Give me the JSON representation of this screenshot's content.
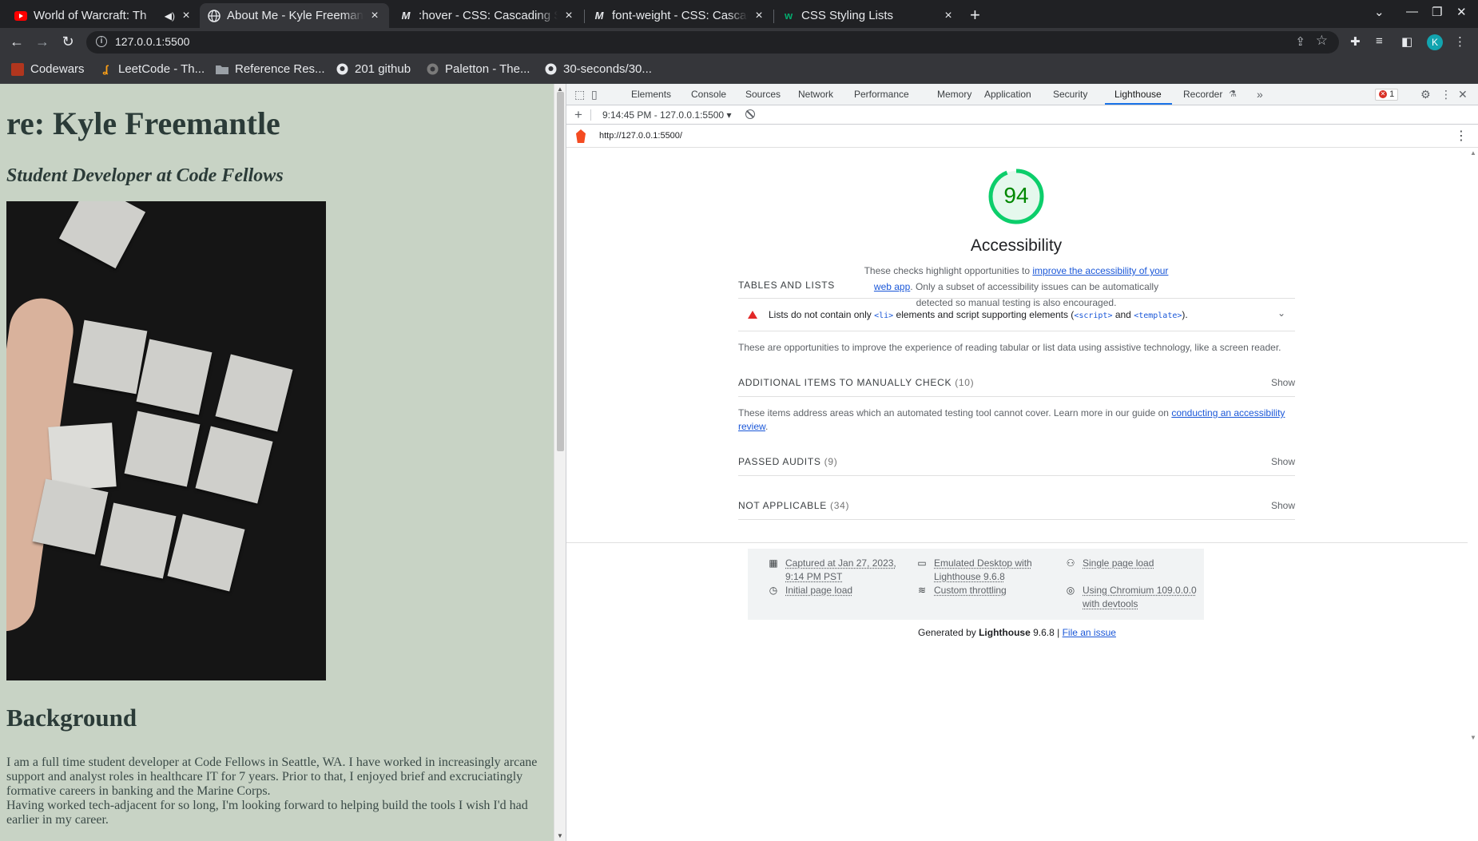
{
  "tabs": [
    {
      "title": "World of Warcraft: Th",
      "favicon": "youtube-icon",
      "audio": true
    },
    {
      "title": "About Me - Kyle Freemant",
      "favicon": "globe-icon",
      "active": true
    },
    {
      "title": ":hover - CSS: Cascading St",
      "favicon": "mdn-icon"
    },
    {
      "title": "font-weight - CSS: Cascad",
      "favicon": "mdn-icon"
    },
    {
      "title": "CSS Styling Lists",
      "favicon": "w3schools-icon"
    }
  ],
  "address": {
    "url": "127.0.0.1:5500"
  },
  "profile_initial": "K",
  "bookmarks": [
    {
      "label": "Codewars",
      "icon": "codewars-icon"
    },
    {
      "label": "LeetCode - Th...",
      "icon": "leetcode-icon"
    },
    {
      "label": "Reference Res...",
      "icon": "folder-icon"
    },
    {
      "label": "201 github",
      "icon": "github-icon"
    },
    {
      "label": "Paletton - The...",
      "icon": "paletton-icon"
    },
    {
      "label": "30-seconds/30...",
      "icon": "github-icon"
    }
  ],
  "page": {
    "heading": "re: Kyle Freemantle",
    "subtitle": "Student Developer at Code Fellows",
    "section_title": "Background",
    "paragraph1": "I am a full time student developer at Code Fellows in Seattle, WA. I have worked in increasingly arcane support and analyst roles in healthcare IT for 7 years. Prior to that, I enjoyed brief and excruciatingly formative careers in banking and the Marine Corps.",
    "paragraph2": "Having worked tech-adjacent for so long, I'm looking forward to helping build the tools I wish I'd had earlier in my career."
  },
  "devtools": {
    "tabs": [
      "Elements",
      "Console",
      "Sources",
      "Network",
      "Performance",
      "Memory",
      "Application",
      "Security",
      "Lighthouse",
      "Recorder"
    ],
    "active_tab": "Lighthouse",
    "error_count": "1",
    "report_selector": "9:14:45 PM - 127.0.0.1:5500",
    "report_url": "http://127.0.0.1:5500/"
  },
  "lighthouse": {
    "score": "94",
    "score_value": 0.94,
    "score_color": "#0cce6b",
    "category": "Accessibility",
    "desc_before": "These checks highlight opportunities to ",
    "desc_link": "improve the accessibility of your web app",
    "desc_after": ". Only a subset of accessibility issues can be automatically detected so manual testing is also encouraged.",
    "groups": {
      "tables": {
        "title": "TABLES AND LISTS",
        "audit_a": "Lists do not contain only ",
        "audit_code1": "<li>",
        "audit_b": " elements and script supporting elements (",
        "audit_code2": "<script>",
        "audit_c": " and ",
        "audit_code3": "<template>",
        "audit_d": ").",
        "description": "These are opportunities to improve the experience of reading tabular or list data using assistive technology, like a screen reader."
      },
      "manual": {
        "title": "ADDITIONAL ITEMS TO MANUALLY CHECK",
        "count": "(10)",
        "show": "Show",
        "desc_before": "These items address areas which an automated testing tool cannot cover. Learn more in our guide on ",
        "desc_link": "conducting an accessibility review",
        "desc_after": "."
      },
      "passed": {
        "title": "PASSED AUDITS",
        "count": "(9)",
        "show": "Show"
      },
      "na": {
        "title": "NOT APPLICABLE",
        "count": "(34)",
        "show": "Show"
      }
    },
    "env": {
      "captured": "Captured at Jan 27, 2023, 9:14 PM PST",
      "initial": "Initial page load",
      "emulated": "Emulated Desktop with Lighthouse 9.6.8",
      "throttling": "Custom throttling",
      "single": "Single page load",
      "chromium": "Using Chromium 109.0.0.0 with devtools"
    },
    "generated_by": "Generated by ",
    "generated_tool": "Lighthouse",
    "generated_version": " 9.6.8 | ",
    "file_issue": "File an issue"
  }
}
